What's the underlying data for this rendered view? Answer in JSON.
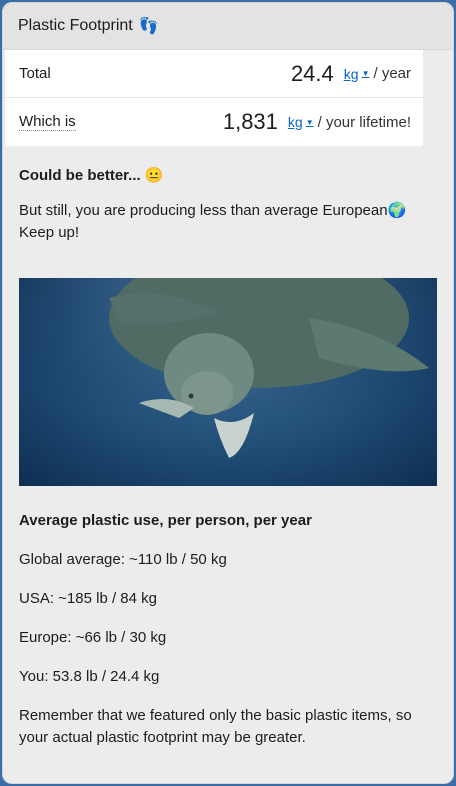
{
  "header": {
    "title": "Plastic Footprint",
    "icon": "footprints-icon"
  },
  "rows": {
    "total": {
      "label": "Total",
      "value": "24.4",
      "unit": "kg",
      "suffix": "/ year"
    },
    "lifetime": {
      "label": "Which is",
      "value": "1,831",
      "unit": "kg",
      "suffix": "/ your lifetime!"
    }
  },
  "verdict": "Could be better... 😐",
  "message_line1": "But still, you are producing less than average European🌍",
  "message_line2": "Keep up!",
  "image": {
    "subject": "sea-turtle-swimming-with-plastic"
  },
  "average": {
    "title": "Average plastic use, per person, per year",
    "global": "Global average: ~110 lb / 50 kg",
    "usa": "USA: ~185 lb / 84 kg",
    "europe": "Europe: ~66 lb / 30 kg",
    "you": "You: 53.8 lb / 24.4 kg"
  },
  "note": "Remember that we featured only the basic plastic items, so your actual plastic footprint may be greater.",
  "colors": {
    "link": "#0a63c9",
    "header_bg": "#e3e3e3",
    "panel_bg": "#ececec"
  }
}
